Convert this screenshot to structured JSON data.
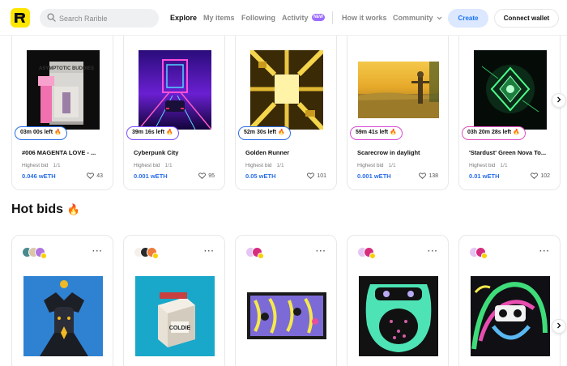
{
  "header": {
    "search_placeholder": "Search Rarible",
    "nav": [
      "Explore",
      "My items",
      "Following",
      "Activity",
      "How it works",
      "Community"
    ],
    "new_badge": "NEW",
    "create_label": "Create",
    "connect_label": "Connect wallet"
  },
  "live_auctions": [
    {
      "timer": "03m 00s  left",
      "title": "#006 MAGENTA LOVE - ...",
      "highest_bid": "Highest bid",
      "edition": "1/1",
      "price": "0.046 wETH",
      "likes": "43"
    },
    {
      "timer": "39m  16s  left",
      "title": "Cyberpunk City",
      "highest_bid": "Highest bid",
      "edition": "1/1",
      "price": "0.001 wETH",
      "likes": "95"
    },
    {
      "timer": "52m  30s  left",
      "title": "Golden Runner",
      "highest_bid": "Highest bid",
      "edition": "1/1",
      "price": "0.05 wETH",
      "likes": "101"
    },
    {
      "timer": "59m  41s  left",
      "title": "Scarecrow in daylight",
      "highest_bid": "Highest bid",
      "edition": "1/1",
      "price": "0.001 wETH",
      "likes": "138"
    },
    {
      "timer": "03h 20m 28s  left",
      "title": "'Stardust' Green Nova To...",
      "highest_bid": "Highest bid",
      "edition": "1/1",
      "price": "0.01 wETH",
      "likes": "102"
    }
  ],
  "hot_bids": {
    "title": "Hot bids",
    "more_label": "···"
  },
  "icons": {
    "fire": "fire-icon",
    "heart": "heart-icon",
    "next": "chevron-right-icon"
  },
  "colors": {
    "brand_yellow": "#fee603",
    "accent_blue": "#2a6de8",
    "new_badge": "#9c6bff"
  }
}
